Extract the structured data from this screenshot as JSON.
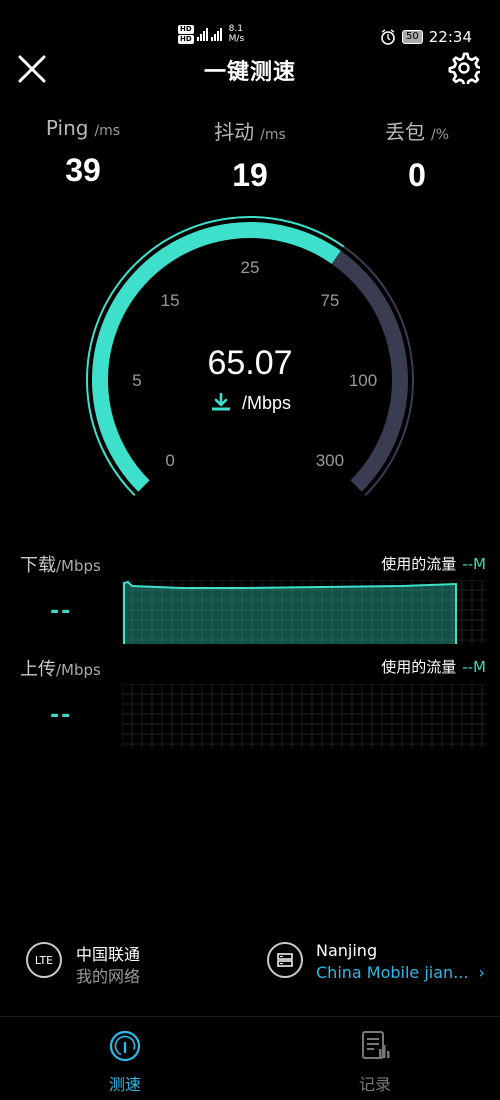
{
  "status_bar": {
    "net_speed_value": "8.1",
    "net_speed_unit": "M/s",
    "battery": "50",
    "time": "22:34"
  },
  "header": {
    "title": "一键测速"
  },
  "metrics": [
    {
      "label": "Ping",
      "unit": "/ms",
      "value": "39"
    },
    {
      "label": "抖动",
      "unit": "/ms",
      "value": "19"
    },
    {
      "label": "丢包",
      "unit": "/%",
      "value": "0"
    }
  ],
  "gauge": {
    "speed": "65.07",
    "unit": "/Mbps",
    "ticks": [
      "0",
      "5",
      "15",
      "25",
      "75",
      "100",
      "300"
    ],
    "progress_fraction": 0.63,
    "colors": {
      "active": "#3ee0cc",
      "track": "#3a3d52"
    }
  },
  "download": {
    "label": "下载",
    "unit": "/Mbps",
    "value": "--",
    "usage_label": "使用的流量",
    "usage_value": "--M"
  },
  "upload": {
    "label": "上传",
    "unit": "/Mbps",
    "value": "--",
    "usage_label": "使用的流量",
    "usage_value": "--M"
  },
  "carrier": {
    "icon_text": "LTE",
    "name": "中国联通",
    "network": "我的网络"
  },
  "server": {
    "city": "Nanjing",
    "provider": "China Mobile jian..."
  },
  "nav": {
    "test_label": "测速",
    "history_label": "记录"
  }
}
